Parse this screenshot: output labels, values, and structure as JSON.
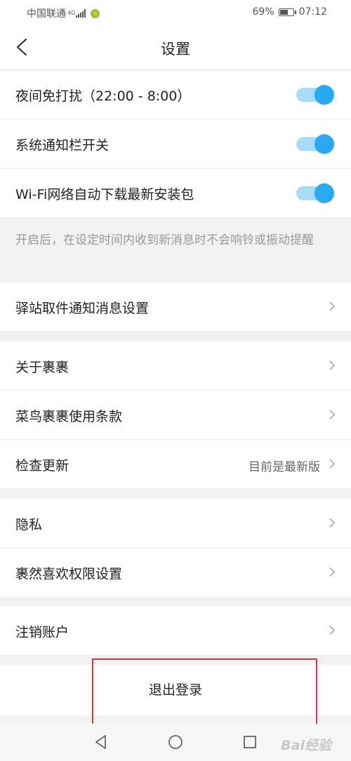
{
  "status_bar": {
    "carrier": "中国联通",
    "network": "4G",
    "battery": "69%",
    "battery_level": 0.69,
    "time": "07:12"
  },
  "header": {
    "title": "设置",
    "back_icon": "chevron-left-icon"
  },
  "toggles": [
    {
      "label": "夜间免打扰（22:00 - 8:00）",
      "on": true
    },
    {
      "label": "系统通知栏开关",
      "on": true
    },
    {
      "label": "Wi-Fi网络自动下载最新安装包",
      "on": true
    }
  ],
  "hint": "开启后，在设定时间内收到新消息时不会响铃或振动提醒",
  "sections": [
    {
      "items": [
        {
          "label": "驿站取件通知消息设置"
        }
      ]
    },
    {
      "items": [
        {
          "label": "关于裹裹"
        },
        {
          "label": "菜鸟裹裹使用条款"
        },
        {
          "label": "检查更新",
          "value": "目前是最新版"
        }
      ]
    },
    {
      "items": [
        {
          "label": "隐私"
        },
        {
          "label": "裹然喜欢权限设置"
        }
      ]
    },
    {
      "items": [
        {
          "label": "注销账户"
        }
      ]
    }
  ],
  "logout": {
    "label": "退出登录"
  },
  "colors": {
    "accent": "#29a9f0",
    "accent_track": "#a8dcf6",
    "highlight": "#d9363e"
  },
  "nav": {
    "icons": [
      "back-triangle-icon",
      "home-circle-icon",
      "recents-square-icon"
    ]
  },
  "watermark": {
    "text": "Bai经验"
  }
}
